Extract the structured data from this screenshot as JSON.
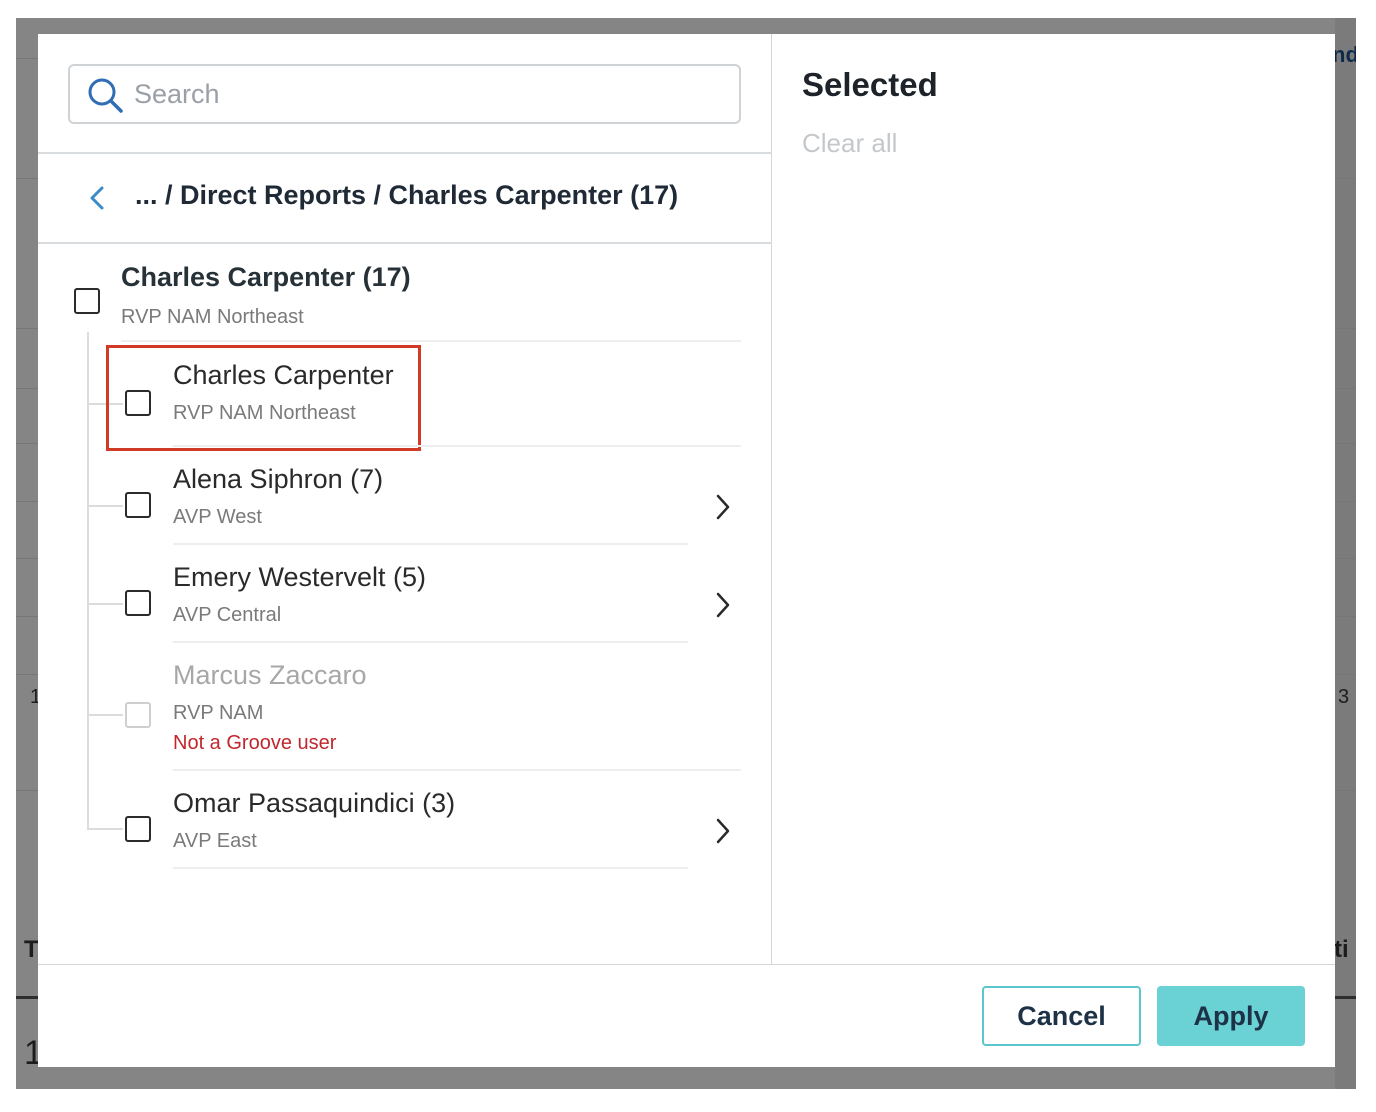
{
  "background_page": {
    "fragments": {
      "top_right": "nd",
      "mid_left": "1",
      "mid_right": "3",
      "lower_left": "T",
      "lower_right": "ti",
      "bottom_left": "1"
    }
  },
  "search": {
    "placeholder": "Search",
    "value": "",
    "icon": "search-icon"
  },
  "breadcrumb": {
    "back_icon": "chevron-left-icon",
    "path": "... / Direct Reports / Charles Carpenter (17)"
  },
  "tree": {
    "root": {
      "name": "Charles Carpenter (17)",
      "title": "RVP NAM Northeast",
      "checked": false
    },
    "children": [
      {
        "name": "Charles Carpenter",
        "title": "RVP NAM Northeast",
        "checked": false,
        "has_children": false,
        "disabled": false,
        "warning": ""
      },
      {
        "name": "Alena Siphron (7)",
        "title": "AVP West",
        "checked": false,
        "has_children": true,
        "disabled": false,
        "warning": ""
      },
      {
        "name": "Emery Westervelt (5)",
        "title": "AVP Central",
        "checked": false,
        "has_children": true,
        "disabled": false,
        "warning": ""
      },
      {
        "name": "Marcus Zaccaro",
        "title": "RVP NAM",
        "checked": false,
        "has_children": false,
        "disabled": true,
        "warning": "Not a Groove user"
      },
      {
        "name": "Omar Passaquindici (3)",
        "title": "AVP East",
        "checked": false,
        "has_children": true,
        "disabled": false,
        "warning": ""
      }
    ]
  },
  "selected_panel": {
    "title": "Selected",
    "clear_all_label": "Clear all",
    "items": []
  },
  "footer": {
    "cancel_label": "Cancel",
    "apply_label": "Apply"
  },
  "colors": {
    "accent_teal": "#6ad1d4",
    "highlight_red": "#d13a26",
    "warning_red": "#c0272d",
    "search_icon_blue": "#2f6db5",
    "back_chevron_blue": "#3a8bc9"
  }
}
